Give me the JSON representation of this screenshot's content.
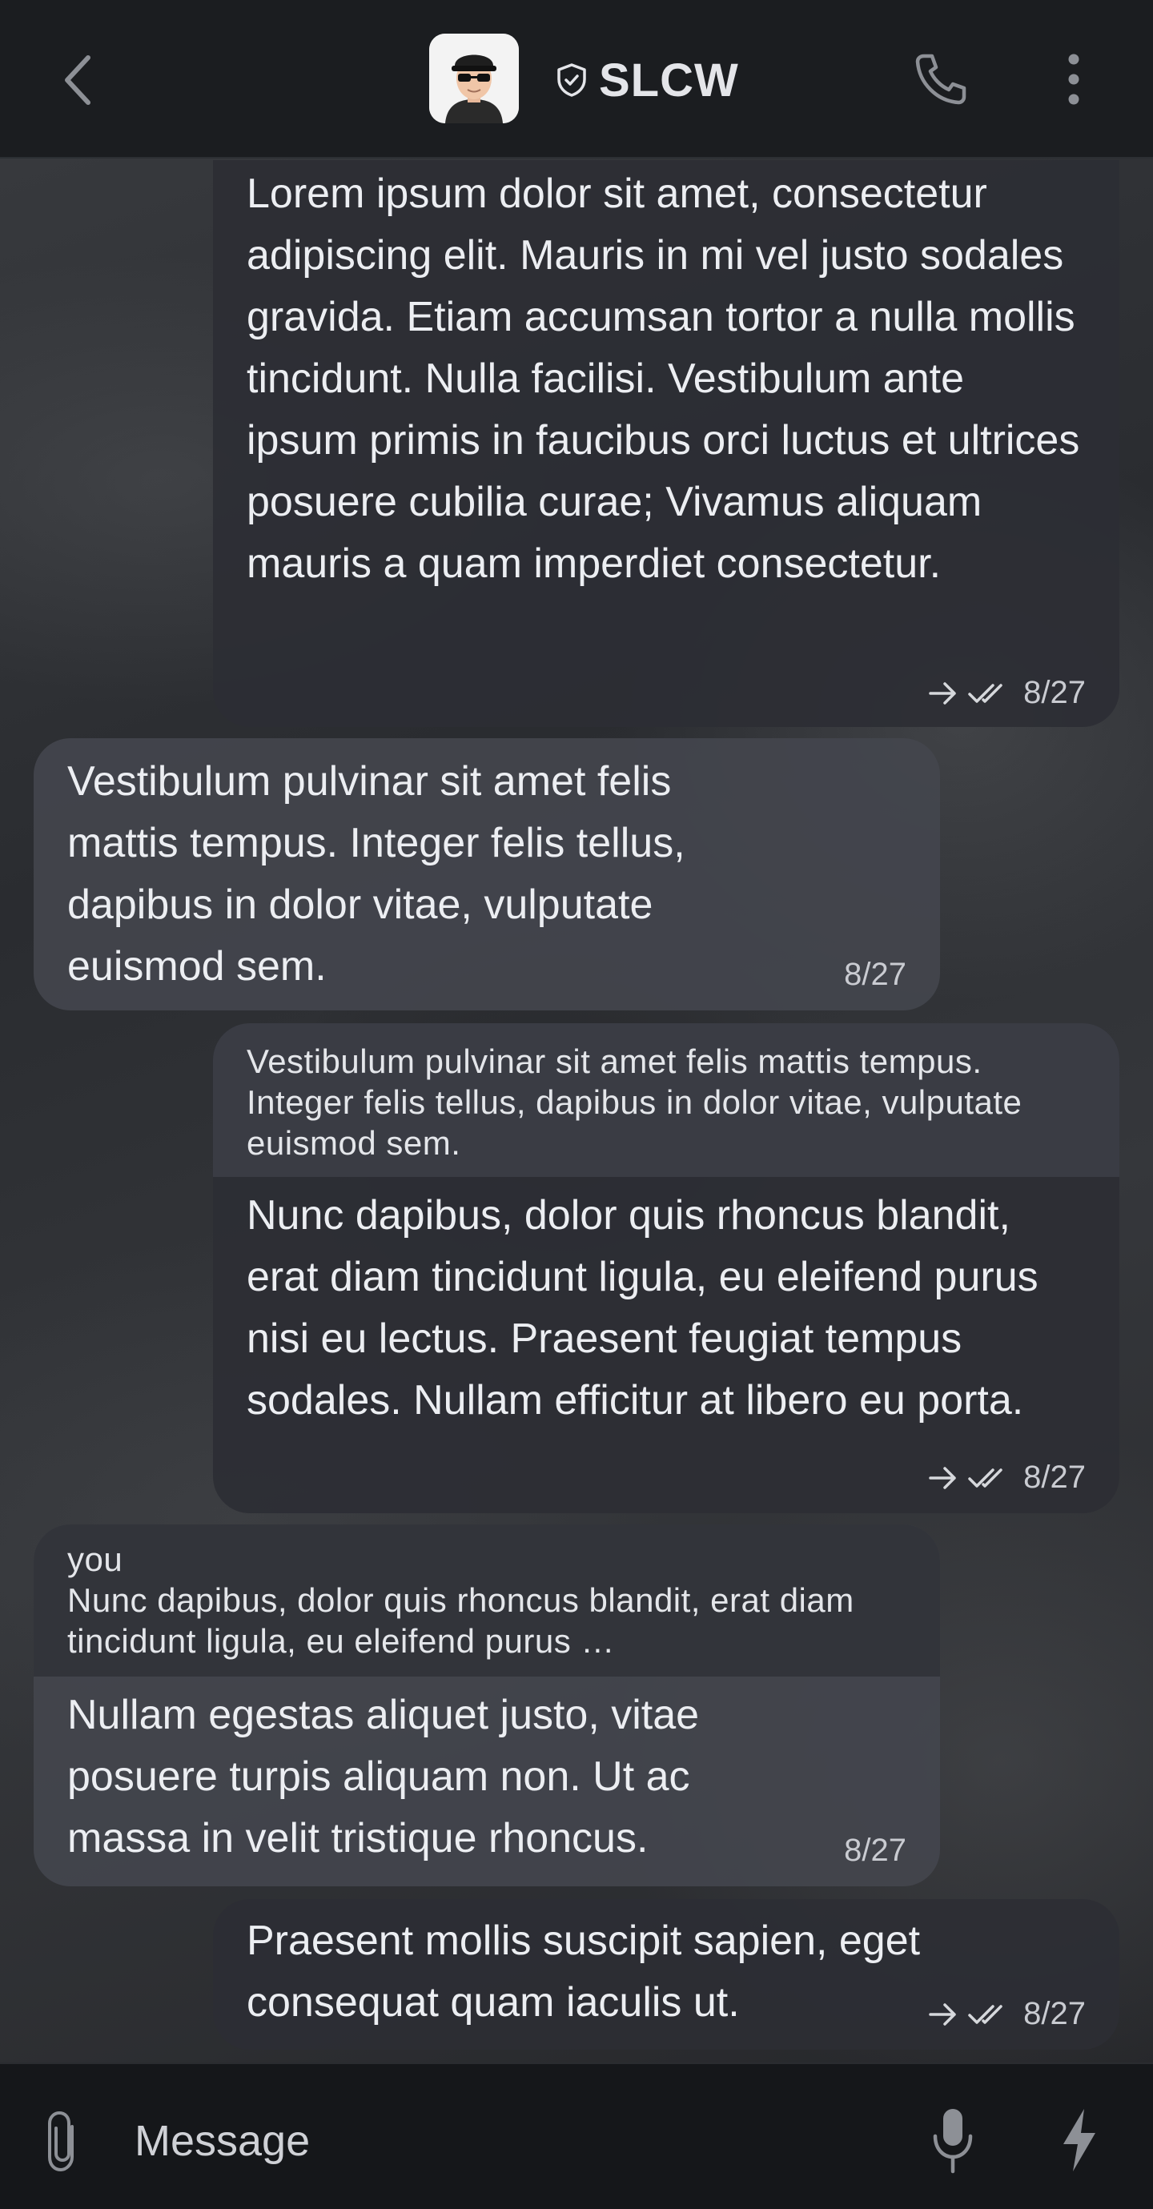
{
  "header": {
    "title": "SLCW",
    "verified_icon": "shield-check-icon",
    "back_icon": "chevron-left-icon",
    "call_icon": "phone-icon",
    "menu_icon": "more-vertical-icon"
  },
  "messages": [
    {
      "direction": "outgoing",
      "text": "Lorem ipsum dolor sit amet, consectetur adipiscing elit. Mauris in mi vel justo sodales gravida. Etiam accumsan tortor a nulla mollis tincidunt. Nulla facilisi. Vestibulum ante ipsum primis in faucibus orci luctus et ultrices posuere cubilia curae; Vivamus aliquam mauris a quam imperdiet consectetur.",
      "time": "8/27",
      "status": "read"
    },
    {
      "direction": "incoming",
      "text": "Vestibulum pulvinar sit amet felis mattis tempus. Integer felis tellus, dapibus in dolor vitae, vulputate euismod sem.",
      "time": "8/27"
    },
    {
      "direction": "outgoing",
      "quote": "Vestibulum pulvinar sit amet felis mattis tempus. Integer felis tellus, dapibus in dolor vitae, vulputate euismod sem.",
      "text": "Nunc dapibus, dolor quis rhoncus blandit, erat diam tincidunt ligula, eu eleifend purus nisi eu lectus. Praesent feugiat tempus sodales. Nullam efficitur at libero eu porta.",
      "time": "8/27",
      "status": "read"
    },
    {
      "direction": "incoming",
      "quote_author": "you",
      "quote": "Nunc dapibus, dolor quis rhoncus blandit, erat diam tincidunt ligula, eu eleifend purus …",
      "text": "Nullam egestas aliquet justo, vitae posuere turpis aliquam non. Ut ac massa in velit tristique rhoncus.",
      "time": "8/27"
    },
    {
      "direction": "outgoing",
      "text": "Praesent mollis suscipit sapien, eget consequat quam iaculis ut.",
      "time": "8/27",
      "status": "read"
    }
  ],
  "composer": {
    "placeholder": "Message",
    "attach_icon": "paperclip-icon",
    "mic_icon": "microphone-icon",
    "bolt_icon": "lightning-bolt-icon"
  },
  "colors": {
    "header_bg": "#1b1d20",
    "outgoing_bubble": "#2c2e34",
    "incoming_bubble": "#44464e",
    "composer_bg": "#15171a"
  }
}
